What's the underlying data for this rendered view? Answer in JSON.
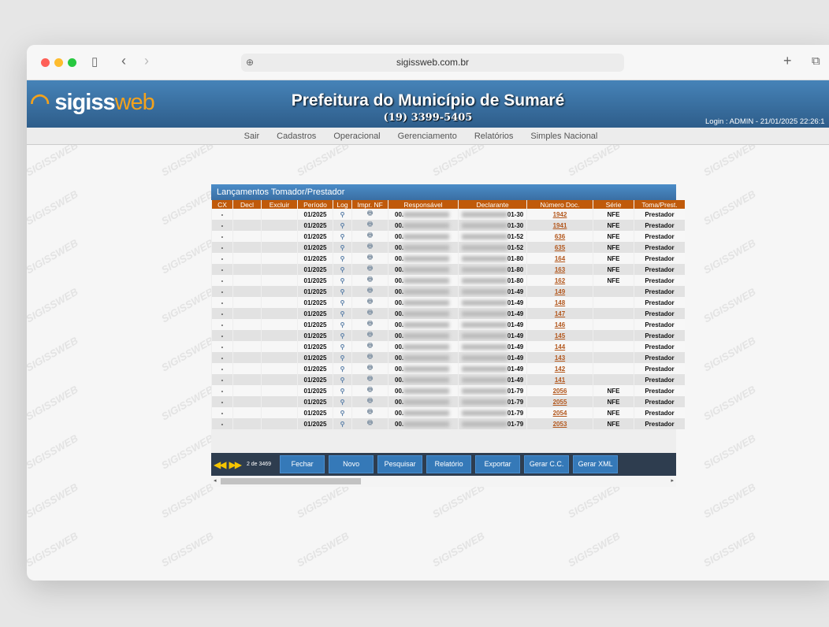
{
  "browser": {
    "url": "sigissweb.com.br"
  },
  "header": {
    "logo_main": "sigiss",
    "logo_accent": "web",
    "title": "Prefeitura do Município de Sumaré",
    "phone": "(19) 3399-5405",
    "login": "Login : ADMIN - 21/01/2025 22:26:1"
  },
  "nav": [
    "Sair",
    "Cadastros",
    "Operacional",
    "Gerenciamento",
    "Relatórios",
    "Simples Nacional"
  ],
  "watermark": "SIGISSWEB",
  "panel": {
    "title": "Lançamentos Tomador/Prestador",
    "columns": [
      "CX",
      "Decl",
      "Excluir",
      "Período",
      "Log",
      "Impr. NF",
      "Responsável",
      "Declarante",
      "Número Doc.",
      "Série",
      "Toma/Prest."
    ],
    "rows": [
      {
        "cx": "-",
        "periodo": "01/2025",
        "resp": "00.",
        "decl": "01-30",
        "num": "1942",
        "serie": "NFE",
        "toma": "Prestador"
      },
      {
        "cx": "-",
        "periodo": "01/2025",
        "resp": "00.",
        "decl": "01-30",
        "num": "1941",
        "serie": "NFE",
        "toma": "Prestador"
      },
      {
        "cx": "-",
        "periodo": "01/2025",
        "resp": "00.",
        "decl": "01-52",
        "num": "636",
        "serie": "NFE",
        "toma": "Prestador"
      },
      {
        "cx": "-",
        "periodo": "01/2025",
        "resp": "00.",
        "decl": "01-52",
        "num": "635",
        "serie": "NFE",
        "toma": "Prestador"
      },
      {
        "cx": "-",
        "periodo": "01/2025",
        "resp": "00.",
        "decl": "01-80",
        "num": "164",
        "serie": "NFE",
        "toma": "Prestador"
      },
      {
        "cx": "-",
        "periodo": "01/2025",
        "resp": "00.",
        "decl": "01-80",
        "num": "163",
        "serie": "NFE",
        "toma": "Prestador"
      },
      {
        "cx": "-",
        "periodo": "01/2025",
        "resp": "00.",
        "decl": "01-80",
        "num": "162",
        "serie": "NFE",
        "toma": "Prestador"
      },
      {
        "cx": "-",
        "periodo": "01/2025",
        "resp": "00.",
        "decl": "01-49",
        "num": "149",
        "serie": "",
        "toma": "Prestador"
      },
      {
        "cx": "-",
        "periodo": "01/2025",
        "resp": "00.",
        "decl": "01-49",
        "num": "148",
        "serie": "",
        "toma": "Prestador"
      },
      {
        "cx": "-",
        "periodo": "01/2025",
        "resp": "00.",
        "decl": "01-49",
        "num": "147",
        "serie": "",
        "toma": "Prestador"
      },
      {
        "cx": "-",
        "periodo": "01/2025",
        "resp": "00.",
        "decl": "01-49",
        "num": "146",
        "serie": "",
        "toma": "Prestador"
      },
      {
        "cx": "-",
        "periodo": "01/2025",
        "resp": "00.",
        "decl": "01-49",
        "num": "145",
        "serie": "",
        "toma": "Prestador"
      },
      {
        "cx": "-",
        "periodo": "01/2025",
        "resp": "00.",
        "decl": "01-49",
        "num": "144",
        "serie": "",
        "toma": "Prestador"
      },
      {
        "cx": "-",
        "periodo": "01/2025",
        "resp": "00.",
        "decl": "01-49",
        "num": "143",
        "serie": "",
        "toma": "Prestador"
      },
      {
        "cx": "-",
        "periodo": "01/2025",
        "resp": "00.",
        "decl": "01-49",
        "num": "142",
        "serie": "",
        "toma": "Prestador"
      },
      {
        "cx": "-",
        "periodo": "01/2025",
        "resp": "00.",
        "decl": "01-49",
        "num": "141",
        "serie": "",
        "toma": "Prestador"
      },
      {
        "cx": "-",
        "periodo": "01/2025",
        "resp": "00.",
        "decl": "01-79",
        "num": "2056",
        "serie": "NFE",
        "toma": "Prestador"
      },
      {
        "cx": "-",
        "periodo": "01/2025",
        "resp": "00.",
        "decl": "01-79",
        "num": "2055",
        "serie": "NFE",
        "toma": "Prestador"
      },
      {
        "cx": "-",
        "periodo": "01/2025",
        "resp": "00.",
        "decl": "01-79",
        "num": "2054",
        "serie": "NFE",
        "toma": "Prestador"
      },
      {
        "cx": "-",
        "periodo": "01/2025",
        "resp": "00.",
        "decl": "01-79",
        "num": "2053",
        "serie": "NFE",
        "toma": "Prestador"
      }
    ]
  },
  "footer": {
    "page": "2 de 3469",
    "buttons": [
      "Fechar",
      "Novo",
      "Pesquisar",
      "Relatório",
      "Exportar",
      "Gerar C.C.",
      "Gerar XML"
    ]
  }
}
